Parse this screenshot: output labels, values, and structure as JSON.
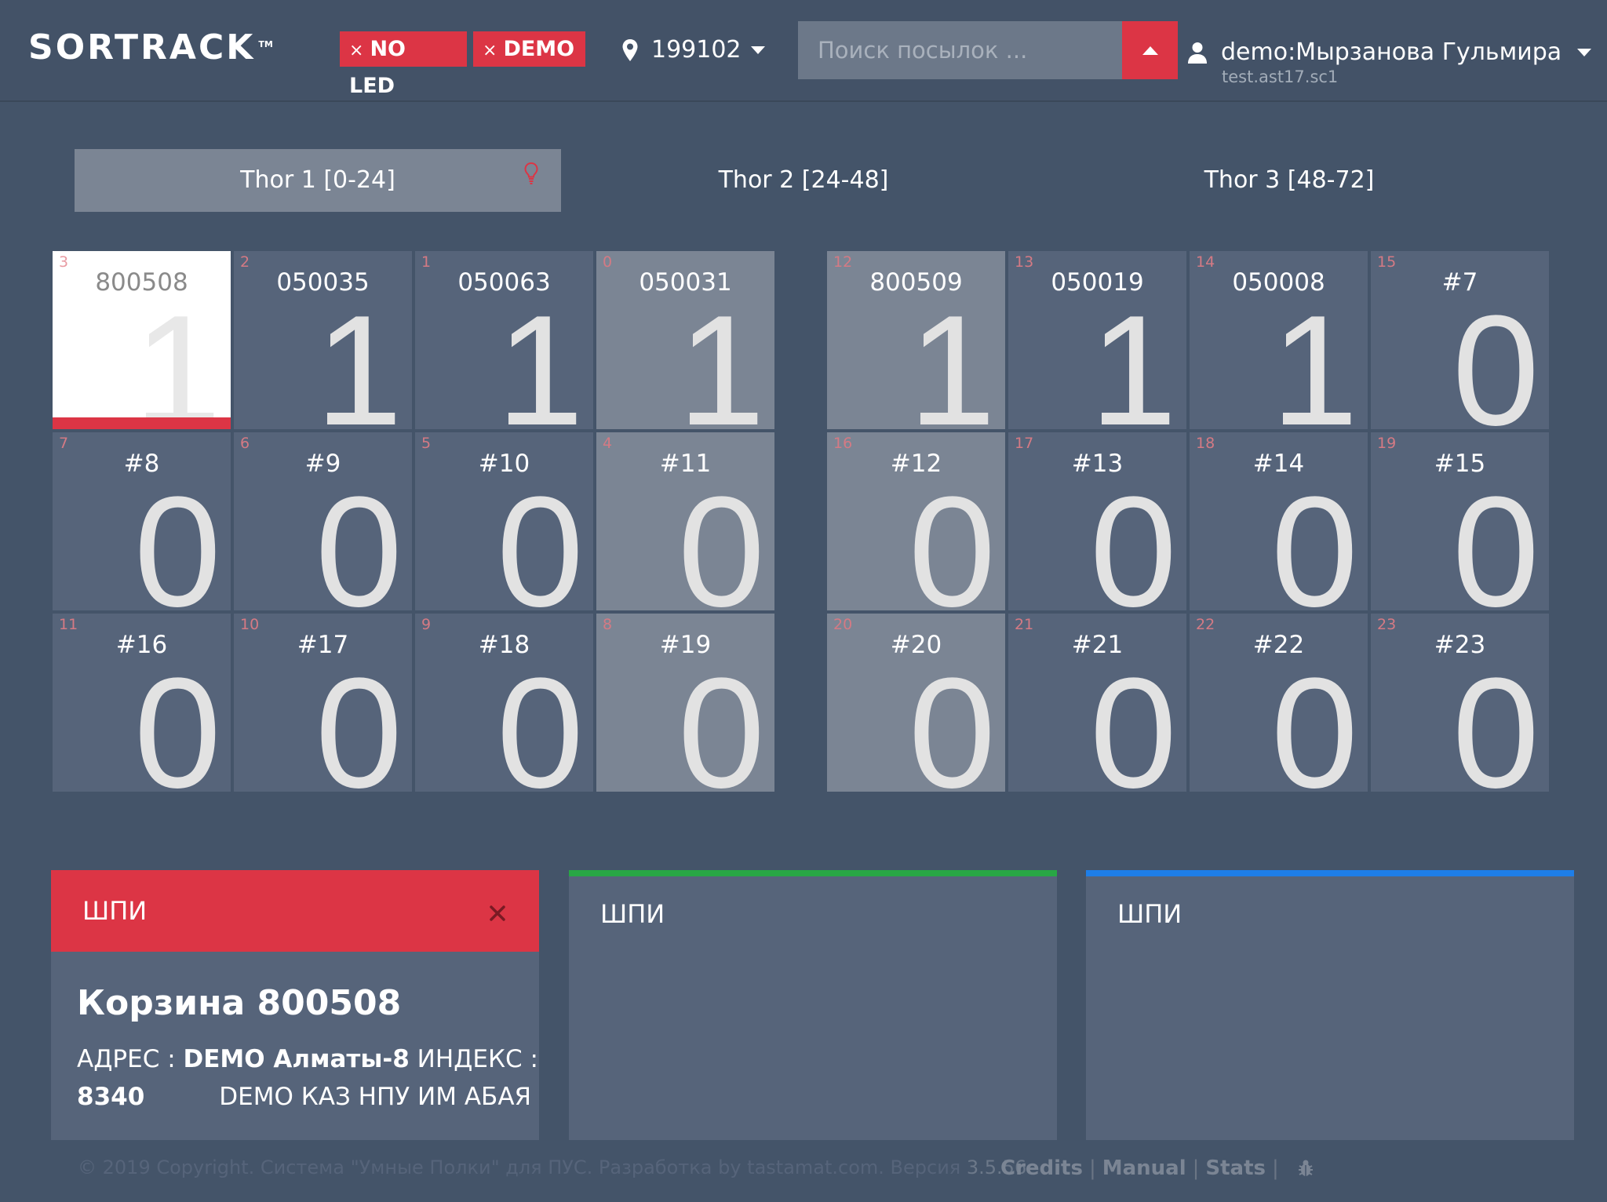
{
  "header": {
    "logo": "SORTRACK",
    "logo_tm": "TM",
    "badges": [
      {
        "x": "×",
        "label": "NO LED"
      },
      {
        "x": "×",
        "label": "DEMO"
      }
    ],
    "location": "199102",
    "search_placeholder": "Поиск посылок ...",
    "user_name": "demo:Мырзанова Гульмира",
    "user_sub": "test.ast17.sc1"
  },
  "tabs": [
    {
      "label": "Thor 1 [0-24]"
    },
    {
      "label": "Thor 2 [24-48]"
    },
    {
      "label": "Thor 3 [48-72]"
    }
  ],
  "cells": [
    {
      "idx": "3",
      "name": "800508",
      "count": "1"
    },
    {
      "idx": "2",
      "name": "050035",
      "count": "1"
    },
    {
      "idx": "1",
      "name": "050063",
      "count": "1"
    },
    {
      "idx": "0",
      "name": "050031",
      "count": "1"
    },
    {
      "idx": "12",
      "name": "800509",
      "count": "1"
    },
    {
      "idx": "13",
      "name": "050019",
      "count": "1"
    },
    {
      "idx": "14",
      "name": "050008",
      "count": "1"
    },
    {
      "idx": "15",
      "name": "#7",
      "count": "0"
    },
    {
      "idx": "7",
      "name": "#8",
      "count": "0"
    },
    {
      "idx": "6",
      "name": "#9",
      "count": "0"
    },
    {
      "idx": "5",
      "name": "#10",
      "count": "0"
    },
    {
      "idx": "4",
      "name": "#11",
      "count": "0"
    },
    {
      "idx": "16",
      "name": "#12",
      "count": "0"
    },
    {
      "idx": "17",
      "name": "#13",
      "count": "0"
    },
    {
      "idx": "18",
      "name": "#14",
      "count": "0"
    },
    {
      "idx": "19",
      "name": "#15",
      "count": "0"
    },
    {
      "idx": "11",
      "name": "#16",
      "count": "0"
    },
    {
      "idx": "10",
      "name": "#17",
      "count": "0"
    },
    {
      "idx": "9",
      "name": "#18",
      "count": "0"
    },
    {
      "idx": "8",
      "name": "#19",
      "count": "0"
    },
    {
      "idx": "20",
      "name": "#20",
      "count": "0"
    },
    {
      "idx": "21",
      "name": "#21",
      "count": "0"
    },
    {
      "idx": "22",
      "name": "#22",
      "count": "0"
    },
    {
      "idx": "23",
      "name": "#23",
      "count": "0"
    }
  ],
  "panels": [
    {
      "head": "ШПИ",
      "title": "Корзина 800508",
      "addr_label": "АДРЕС : ",
      "addr_value": "DEMO Алматы-8",
      "index_label": " ИНДЕКС :",
      "index_value": "8340",
      "index_name": "DEMO КАЗ НПУ ИМ АБАЯ"
    },
    {
      "head": "ШПИ"
    },
    {
      "head": "ШПИ"
    }
  ],
  "footer": {
    "copyright": "© 2019 Copyright. Система \"Умные Полки\" для ПУС. Разработка by tastamat.com. Версия ",
    "version": "3.5.56",
    "links": [
      "Credits",
      "Manual",
      "Stats"
    ],
    "sep": "|"
  },
  "colors": {
    "background": "#445469",
    "accent_red": "#dc3545",
    "accent_green": "#28a745",
    "accent_blue": "#1e7ee8",
    "cell_dark": "#56647a",
    "cell_light": "#7b8594"
  },
  "icons": [
    "map-pin-icon",
    "caret-down-icon",
    "caret-up-icon",
    "user-icon",
    "lightbulb-icon",
    "close-icon",
    "bug-icon"
  ]
}
